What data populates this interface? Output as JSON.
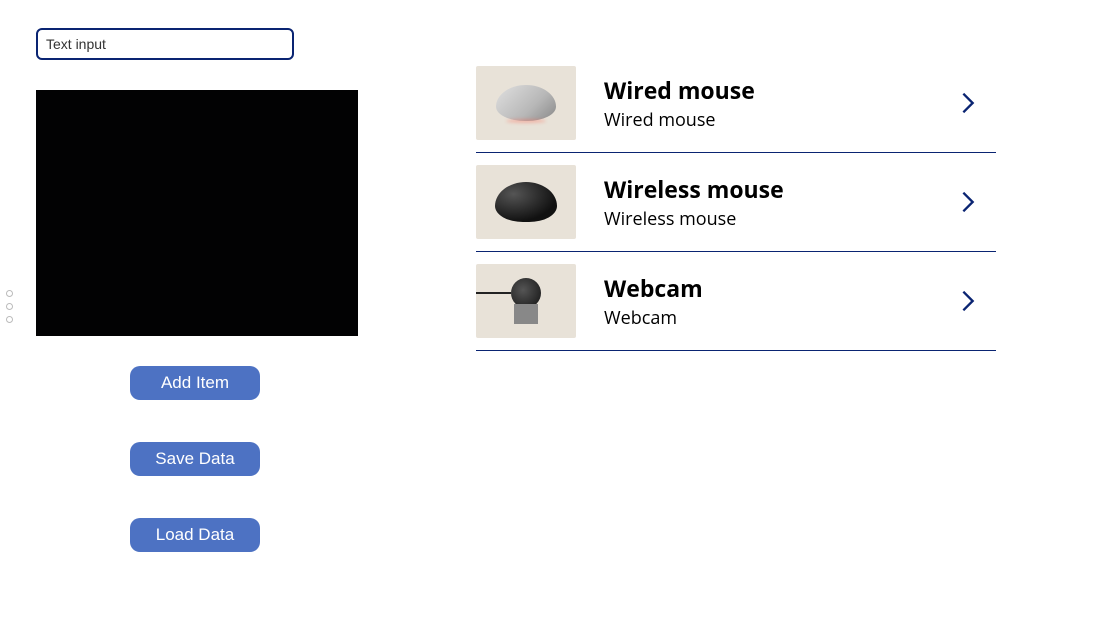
{
  "left": {
    "input_placeholder": "Text input",
    "buttons": {
      "add_item": "Add Item",
      "save_data": "Save Data",
      "load_data": "Load Data"
    }
  },
  "list": {
    "items": [
      {
        "title": "Wired mouse",
        "subtitle": "Wired mouse",
        "icon": "wired-mouse"
      },
      {
        "title": "Wireless mouse",
        "subtitle": "Wireless mouse",
        "icon": "wireless-mouse"
      },
      {
        "title": "Webcam",
        "subtitle": "Webcam",
        "icon": "webcam"
      }
    ]
  },
  "colors": {
    "accent": "#0a2472",
    "button": "#4d72c3"
  }
}
